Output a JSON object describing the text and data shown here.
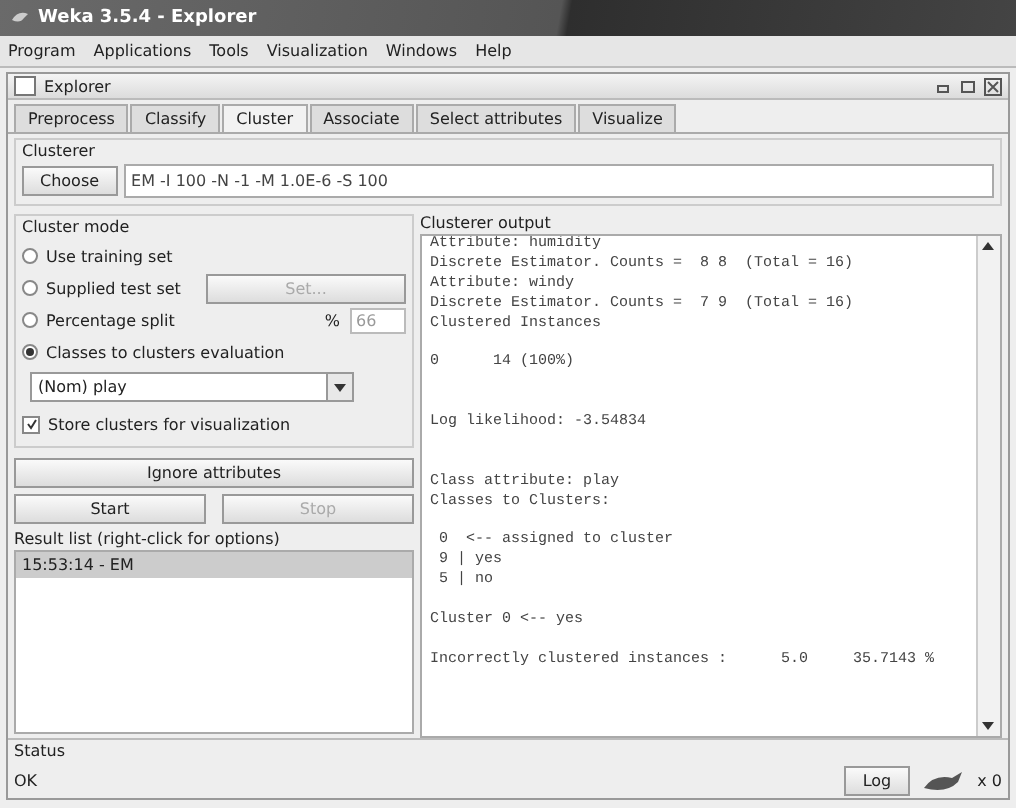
{
  "window": {
    "title": "Weka 3.5.4 - Explorer"
  },
  "menu": [
    "Program",
    "Applications",
    "Tools",
    "Visualization",
    "Windows",
    "Help"
  ],
  "inner_window": {
    "title": "Explorer"
  },
  "tabs": [
    {
      "label": "Preprocess",
      "selected": false
    },
    {
      "label": "Classify",
      "selected": false
    },
    {
      "label": "Cluster",
      "selected": true
    },
    {
      "label": "Associate",
      "selected": false
    },
    {
      "label": "Select attributes",
      "selected": false
    },
    {
      "label": "Visualize",
      "selected": false
    }
  ],
  "clusterer": {
    "heading": "Clusterer",
    "button": "Choose",
    "value": "EM -I 100 -N -1 -M 1.0E-6 -S 100"
  },
  "cluster_mode": {
    "heading": "Cluster mode",
    "options": [
      {
        "label": "Use training set",
        "selected": false
      },
      {
        "label": "Supplied test set",
        "selected": false,
        "button": {
          "label": "Set...",
          "disabled": true
        }
      },
      {
        "label": "Percentage split",
        "selected": false,
        "unit": "%",
        "value": "66"
      },
      {
        "label": "Classes to clusters evaluation",
        "selected": true
      }
    ],
    "class_dropdown": "(Nom) play",
    "store_checkbox": {
      "label": "Store clusters for visualization",
      "checked": true
    }
  },
  "ignore_button": "Ignore attributes",
  "start_button": {
    "label": "Start",
    "disabled": false
  },
  "stop_button": {
    "label": "Stop",
    "disabled": true
  },
  "result_list": {
    "heading": "Result list (right-click for options)",
    "items": [
      {
        "label": "15:53:14 - EM",
        "selected": true
      }
    ]
  },
  "output": {
    "heading": "Clusterer output",
    "text": "Attribute: humidity\nDiscrete Estimator. Counts =  8 8  (Total = 16)\nAttribute: windy\nDiscrete Estimator. Counts =  7 9  (Total = 16)\nClustered Instances\n\n0      14 (100%)\n\n\nLog likelihood: -3.54834\n\n\nClass attribute: play\nClasses to Clusters:\n\n 0  <-- assigned to cluster\n 9 | yes\n 5 | no\n\nCluster 0 <-- yes\n\nIncorrectly clustered instances :      5.0     35.7143 %"
  },
  "status": {
    "heading": "Status",
    "text": "OK",
    "log_button": "Log",
    "count": "x 0"
  }
}
